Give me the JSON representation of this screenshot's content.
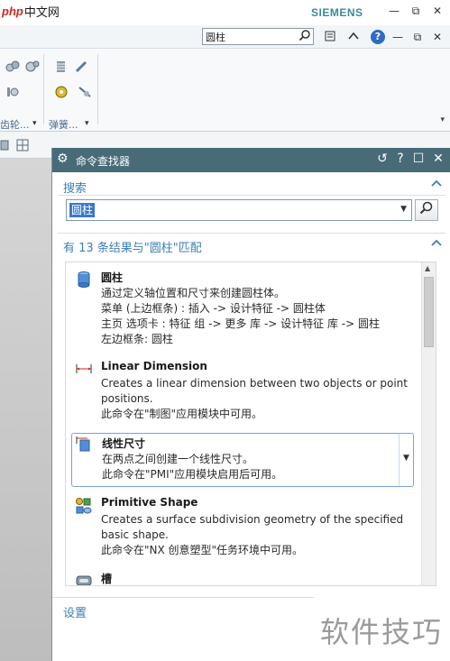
{
  "titlebar": {
    "logo_php": "php",
    "logo_text": "中文网",
    "brand": "SIEMENS"
  },
  "helpbar": {
    "search_value": "圆柱"
  },
  "ribbon": {
    "group1_label": "齿轮...",
    "group2_label": "弹簧..."
  },
  "dialog": {
    "title": "命令查找器",
    "search_section": "搜索",
    "search_value": "圆柱",
    "results_header": "有 13 条结果与\"圆柱\"匹配",
    "settings_label": "设置",
    "items": [
      {
        "name": "圆柱",
        "lines": [
          "通过定义轴位置和尺寸来创建圆柱体。",
          "菜单 (上边框条) : 插入 -> 设计特征 -> 圆柱体",
          "主页 选项卡 : 特征 组 -> 更多 库 -> 设计特征 库 -> 圆柱",
          "左边框条: 圆柱"
        ]
      },
      {
        "name": "Linear Dimension",
        "lines": [
          "Creates a linear dimension between two objects or point",
          "positions.",
          "此命令在\"制图\"应用模块中可用。"
        ]
      },
      {
        "name": "线性尺寸",
        "lines": [
          "在两点之间创建一个线性尺寸。",
          "此命令在\"PMI\"应用模块启用后可用。"
        ]
      },
      {
        "name": "Primitive Shape",
        "lines": [
          "Creates a surface subdivision geometry of the specified",
          "basic shape.",
          "此命令在\"NX 创意塑型\"任务环境中可用。"
        ]
      },
      {
        "name": "槽",
        "lines": []
      }
    ]
  },
  "watermark": "软件技巧",
  "colors": {
    "dialog_title_bg": "#486b78",
    "section_text": "#3d7fb8",
    "selection_bg": "#3a78c9",
    "brand": "#3b8a9a"
  }
}
